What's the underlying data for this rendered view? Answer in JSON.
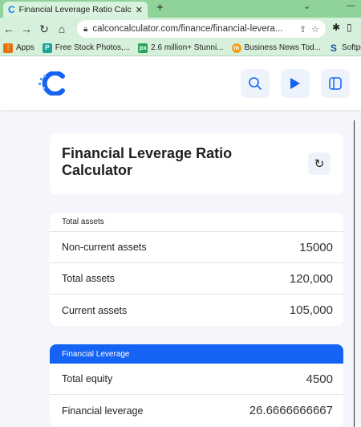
{
  "browser": {
    "tab_title": "Financial Leverage Ratio Calculat",
    "url": "calconcalculator.com/finance/financial-levera..."
  },
  "bookmarks": [
    {
      "label": "Apps",
      "icon": "apps-grid-icon",
      "color": "#e8710a"
    },
    {
      "label": "Free Stock Photos,...",
      "icon": "pexels-icon",
      "color": "#1ba39c"
    },
    {
      "label": "2.6 million+ Stunni...",
      "icon": "px-icon",
      "color": "#2aa35a"
    },
    {
      "label": "Business News Tod...",
      "icon": "news-icon",
      "color": "#f29d1a"
    },
    {
      "label": "Softpedi",
      "icon": "softpedia-icon",
      "color": "#1a4fa0"
    }
  ],
  "calculator": {
    "title": "Financial Leverage Ratio Calculator",
    "sections": [
      {
        "heading": "Total assets",
        "rows": [
          {
            "label": "Non-current assets",
            "value": "15000"
          },
          {
            "label": "Total assets",
            "value": "120,000"
          },
          {
            "label": "Current assets",
            "value": "105,000"
          }
        ]
      },
      {
        "heading": "Financial Leverage",
        "rows": [
          {
            "label": "Total equity",
            "value": "4500"
          },
          {
            "label": "Financial leverage",
            "value": "26.6666666667"
          }
        ]
      }
    ]
  },
  "colors": {
    "accent": "#1463f3",
    "chrome_green": "#8fd39b"
  }
}
